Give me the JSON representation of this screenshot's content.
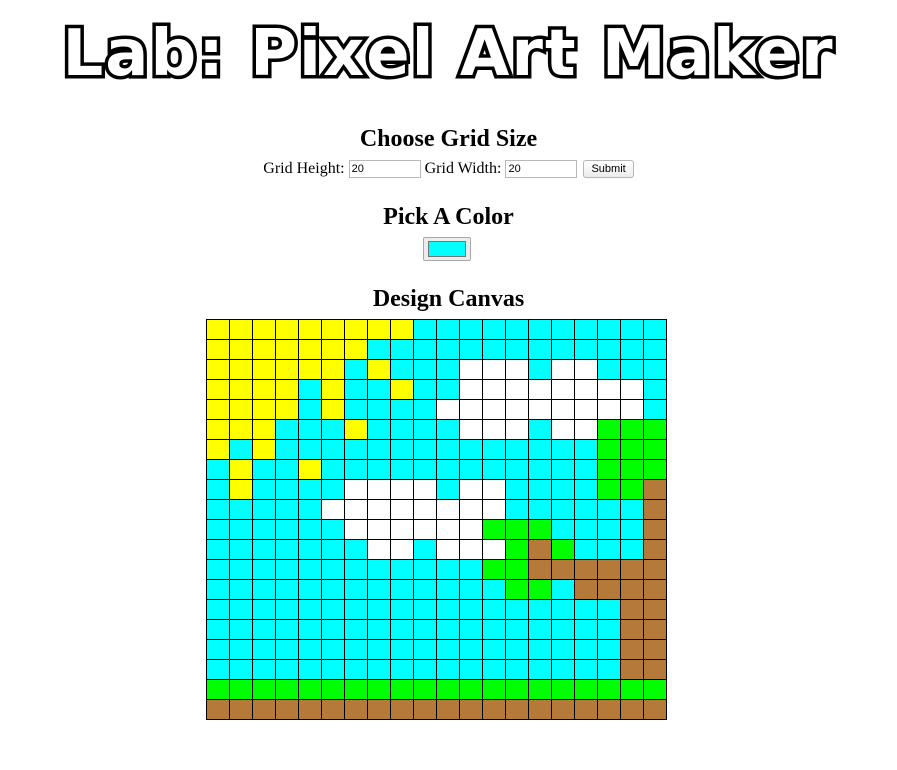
{
  "header": {
    "title": "Lab: Pixel Art Maker"
  },
  "grid_size": {
    "title": "Choose Grid Size",
    "height_label": "Grid Height:",
    "height_value": "20",
    "width_label": "Grid Width:",
    "width_value": "20",
    "submit_label": "Submit"
  },
  "color": {
    "title": "Pick A Color",
    "selected": "#00ffff"
  },
  "canvas": {
    "title": "Design Canvas",
    "palette": {
      "Y": "#ffff00",
      "C": "#00ffff",
      "W": "#ffffff",
      "G": "#00ff00",
      "B": "#b5793a"
    },
    "rows": [
      "YYYYYYYYYCCCCCCCCCCC",
      "YYYYYYYCCCCCCCCCCCCC",
      "YYYYYYCYCCCWWWCWWCCC",
      "YYYYCYCCYCCWWWWWWWWC",
      "YYYYCYCCCCWWWWWWWWWC",
      "YYYCCCYCCCCWWWCWWGGG",
      "YCYCCCCCCCCCCCCCCGGG",
      "CYCCYCCCCCCCCCCCCGGG",
      "CYCCCCWWWWCWWCCCCGGB",
      "CCCCCWWWWWWWWCCCCCCB",
      "CCCCCCWWWWWWGGGCCCCB",
      "CCCCCCCWWCWWWGBGCCCB",
      "CCCCCCCCCCCCGGBBBBBB",
      "CCCCCCCCCCCCCGGCBBBB",
      "CCCCCCCCCCCCCCCCCCBB",
      "CCCCCCCCCCCCCCCCCCBB",
      "CCCCCCCCCCCCCCCCCCBB",
      "CCCCCCCCCCCCCCCCCCBB",
      "GGGGGGGGGGGGGGGGGGGG",
      "BBBBBBBBBBBBBBBBBBBB"
    ]
  }
}
